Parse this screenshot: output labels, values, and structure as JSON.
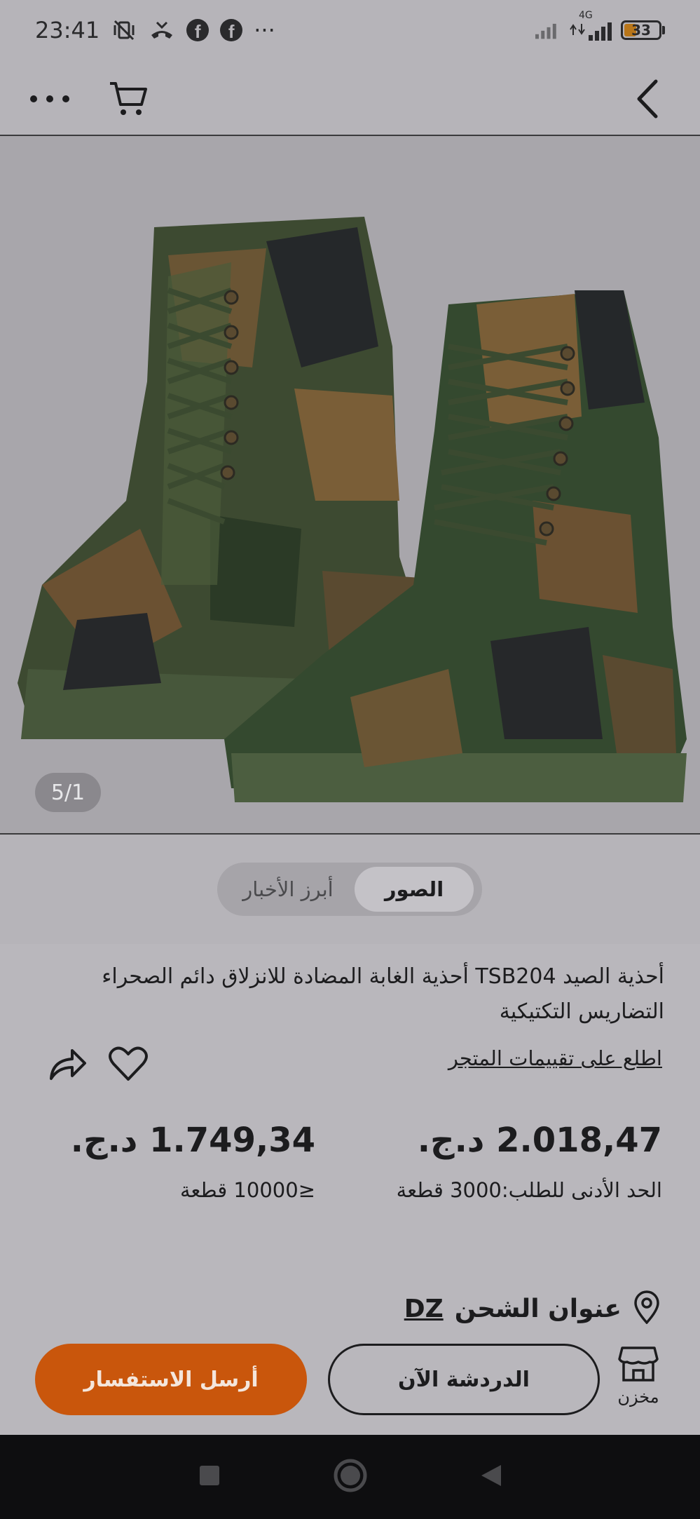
{
  "status_bar": {
    "time": "23:41",
    "more_dots": "···",
    "network": "4G",
    "battery_level": "33",
    "battery_color": "#b8761a"
  },
  "nav": {
    "back_icon": "chevron-left-icon",
    "cart_icon": "cart-icon",
    "more_icon": "more-horizontal-icon"
  },
  "gallery": {
    "counter": "5/1",
    "tabs": [
      {
        "label": "الصور",
        "selected": true
      },
      {
        "label": "أبرز الأخبار",
        "selected": false
      }
    ]
  },
  "product": {
    "title": "أحذية الصيد TSB204 أحذية الغابة المضادة للانزلاق دائم الصحراء التضاريس التكتيكية",
    "store_reviews_link": "اطلع على تقييمات المتجر",
    "prices": [
      {
        "amount": "2.018,47 د.ج.",
        "quantity": "الحد الأدنى للطلب:3000 قطعة"
      },
      {
        "amount": "1.749,34 د.ج.",
        "quantity": "≤10000 قطعة"
      }
    ]
  },
  "shipping": {
    "label": "عنوان الشحن",
    "code": "DZ"
  },
  "actions": {
    "store_label": "مخزن",
    "chat_label": "الدردشة الآن",
    "inquiry_label": "أرسل الاستفسار",
    "accent_color": "#c9560c"
  }
}
